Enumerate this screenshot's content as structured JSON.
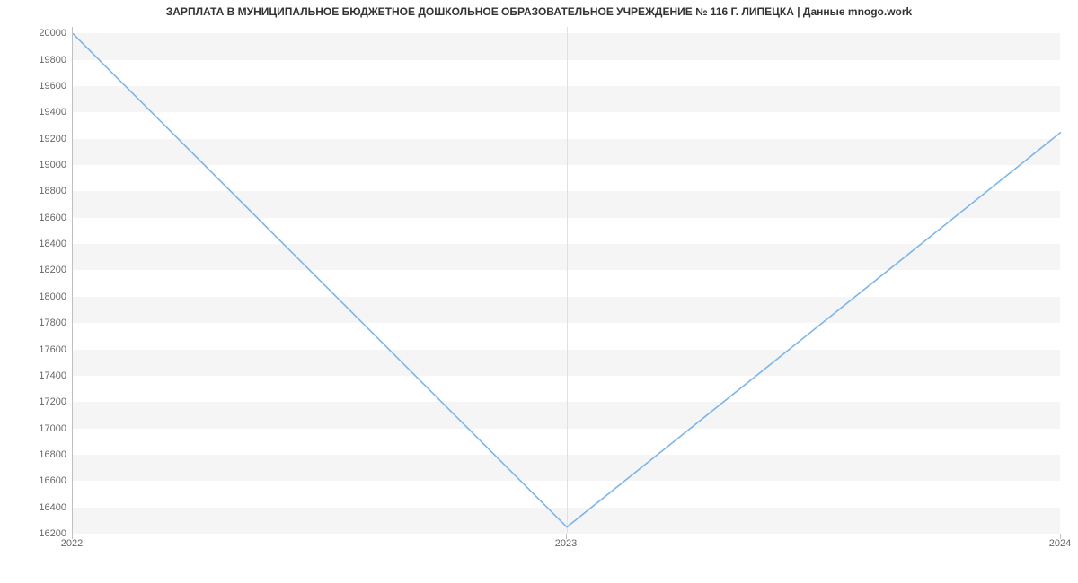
{
  "chart_data": {
    "type": "line",
    "title": "ЗАРПЛАТА В МУНИЦИПАЛЬНОЕ БЮДЖЕТНОЕ ДОШКОЛЬНОЕ ОБРАЗОВАТЕЛЬНОЕ УЧРЕЖДЕНИЕ № 116 Г. ЛИПЕЦКА | Данные mnogo.work",
    "x": [
      2022,
      2023,
      2024
    ],
    "values": [
      20000,
      16250,
      19250
    ],
    "xlabel": "",
    "ylabel": "",
    "ylim": [
      16200,
      20050
    ],
    "y_ticks": [
      16200,
      16400,
      16600,
      16800,
      17000,
      17200,
      17400,
      17600,
      17800,
      18000,
      18200,
      18400,
      18600,
      18800,
      19000,
      19200,
      19400,
      19600,
      19800,
      20000
    ],
    "x_ticks": [
      2022,
      2023,
      2024
    ],
    "line_color": "#7cb5ec",
    "band_color": "#f5f5f5"
  }
}
